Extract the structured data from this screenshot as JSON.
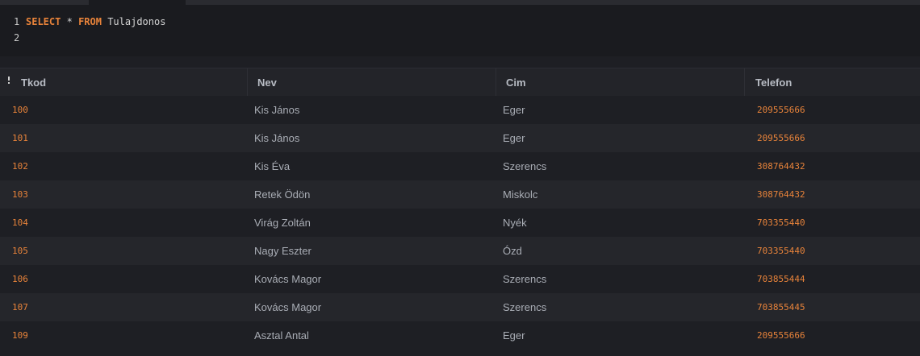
{
  "editor": {
    "lines": [
      {
        "num": "1",
        "kw1": "SELECT",
        "op": "*",
        "kw2": "FROM",
        "ident": "Tulajdonos"
      },
      {
        "num": "2"
      }
    ]
  },
  "grid": {
    "columns": [
      "Tkod",
      "Nev",
      "Cim",
      "Telefon"
    ],
    "rows": [
      {
        "tkod": "100",
        "nev": "Kis János",
        "cim": "Eger",
        "telefon": "209555666"
      },
      {
        "tkod": "101",
        "nev": "Kis János",
        "cim": "Eger",
        "telefon": "209555666"
      },
      {
        "tkod": "102",
        "nev": "Kis Éva",
        "cim": "Szerencs",
        "telefon": "308764432"
      },
      {
        "tkod": "103",
        "nev": "Retek Ödön",
        "cim": "Miskolc",
        "telefon": "308764432"
      },
      {
        "tkod": "104",
        "nev": "Virág Zoltán",
        "cim": "Nyék",
        "telefon": "703355440"
      },
      {
        "tkod": "105",
        "nev": "Nagy Eszter",
        "cim": "Ózd",
        "telefon": "703355440"
      },
      {
        "tkod": "106",
        "nev": "Kovács Magor",
        "cim": "Szerencs",
        "telefon": "703855444"
      },
      {
        "tkod": "107",
        "nev": "Kovács Magor",
        "cim": "Szerencs",
        "telefon": "703855445"
      },
      {
        "tkod": "109",
        "nev": "Asztal Antal",
        "cim": "Eger",
        "telefon": "209555666"
      }
    ]
  },
  "colors": {
    "keyword": "#e8833a",
    "number": "#e8833a",
    "text": "#a9adb5",
    "header_bg": "#232429",
    "row_alt_bg": "#25262b"
  },
  "icons": {
    "sort": "column-sort-icon"
  }
}
